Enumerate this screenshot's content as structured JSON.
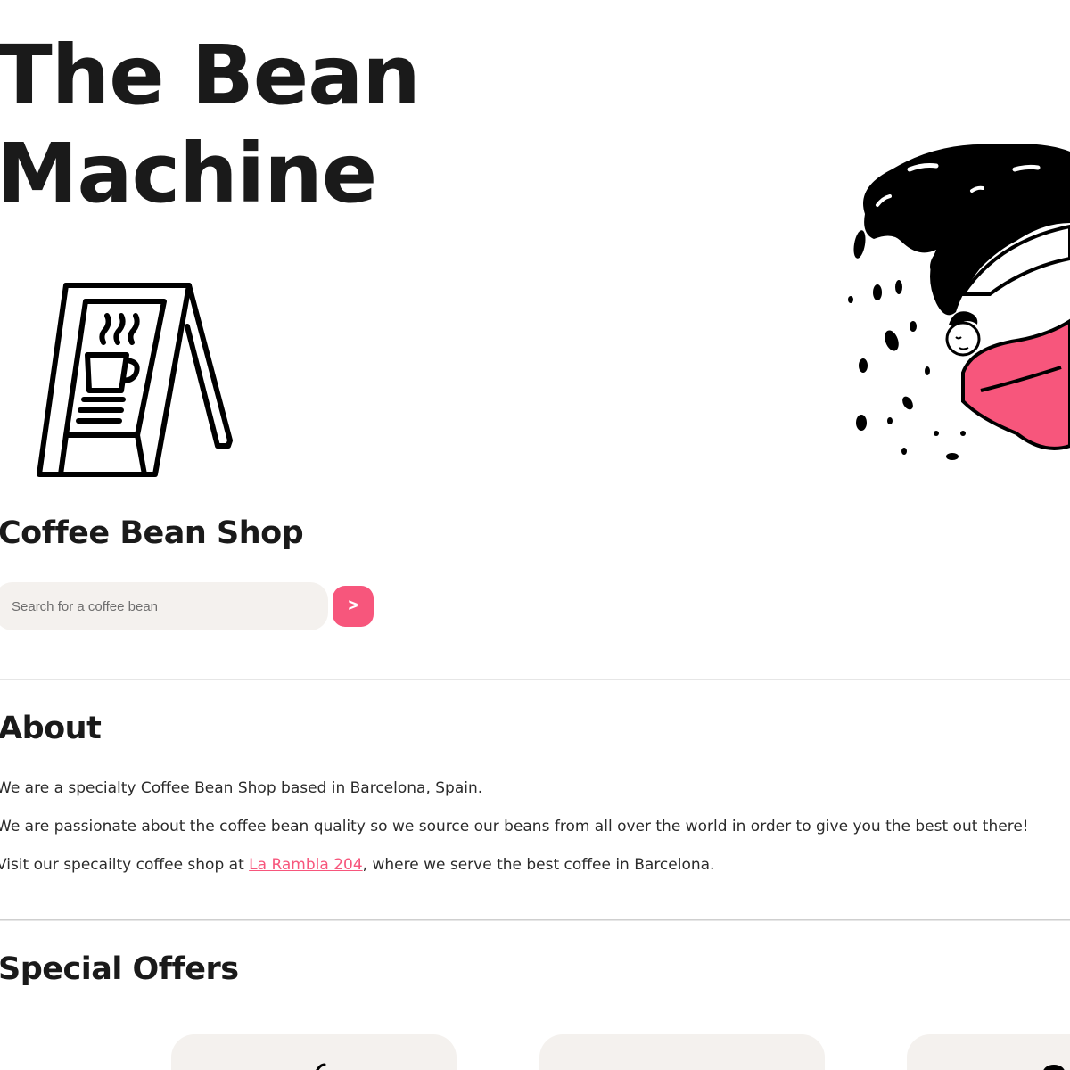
{
  "header": {
    "title": "The Bean Machine"
  },
  "hero": {
    "subtitle": "Coffee Bean Shop",
    "search": {
      "placeholder": "Search for a coffee bean",
      "value": "",
      "button_label": ">"
    }
  },
  "about": {
    "heading": "About",
    "paragraph_1": "We are a specialty Coffee Bean Shop based in Barcelona, Spain.",
    "paragraph_2": "We are passionate about the coffee bean quality so we source our beans from all over the world in order to give you the best out there!",
    "paragraph_3_prefix": "Visit our specailty coffee shop at",
    "paragraph_3_link": "La Rambla 204",
    "paragraph_3_suffix": ", where we serve the best coffee in Barcelona."
  },
  "offers": {
    "heading": "Special Offers"
  },
  "colors": {
    "accent": "#f7567c",
    "input_background": "#f4f1ee",
    "card_background": "#f4f1ee",
    "text": "#1d1d1d"
  },
  "icons": {
    "sign": "coffee-sign-icon",
    "illustration": "coffee-splash-illustration"
  }
}
